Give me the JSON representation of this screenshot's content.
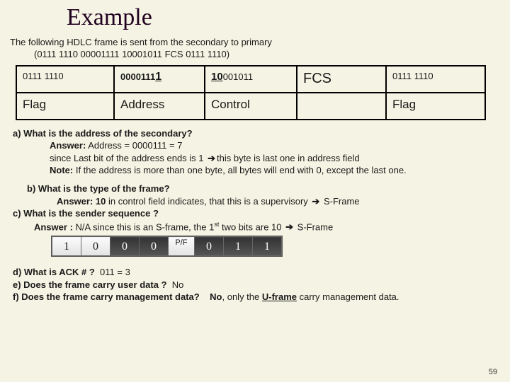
{
  "title": "Example",
  "intro_line1": "The following HDLC frame is sent from the secondary to primary",
  "intro_line2": "(0111 1110  00001111  10001011 FCS 0111 1110)",
  "frame": {
    "row1": {
      "c1": "0111 1110",
      "c2_pre": "0000111",
      "c2_hl": "1",
      "c3_hl": "10",
      "c3_post": "001011",
      "c4": "FCS",
      "c5": "0111 1110"
    },
    "row2": {
      "c1": "Flag",
      "c2": "Address",
      "c3": "Control",
      "c4": "",
      "c5": "Flag"
    }
  },
  "qa": {
    "a_q": "a) What is the address of the secondary?",
    "a_a1": "Answer:",
    "a_a1b": "Address = 0000111 = 7",
    "a_a2a": "since Last bit of the address ends is 1 ",
    "a_a2b": "this byte is last one in address field",
    "a_note_label": "Note:",
    "a_note": "If the address is more than one byte, all bytes will end with 0, except the last one.",
    "b_q": "b)  What is the type of the frame?",
    "b_a_label": "Answer:",
    "b_a_pre": " ",
    "b_a_hl": "10",
    "b_a_mid": " in control field indicates, that this is a supervisory ",
    "b_a_post": " S-Frame",
    "c_q": "c) What is the sender sequence ?",
    "c_a_label": "Answer :",
    "c_a_pre": " N/A since this is an S-frame, the 1",
    "c_a_sup": "st",
    "c_a_mid": " two bits are 10 ",
    "c_a_post": " S-Frame",
    "d": "d) What is ACK # ?",
    "d_v": "011  = 3",
    "e": "e) Does the frame carry user data ?",
    "e_v": "No",
    "f": "f) Does the frame carry management data?",
    "f_v1": "No",
    "f_v2": ", only the ",
    "f_uf": "U-frame",
    "f_v3": " carry management data."
  },
  "ctrl_bits": [
    "1",
    "0",
    "0",
    "0",
    "P/F",
    "0",
    "1",
    "1"
  ],
  "arrow": "➔",
  "page": "59"
}
